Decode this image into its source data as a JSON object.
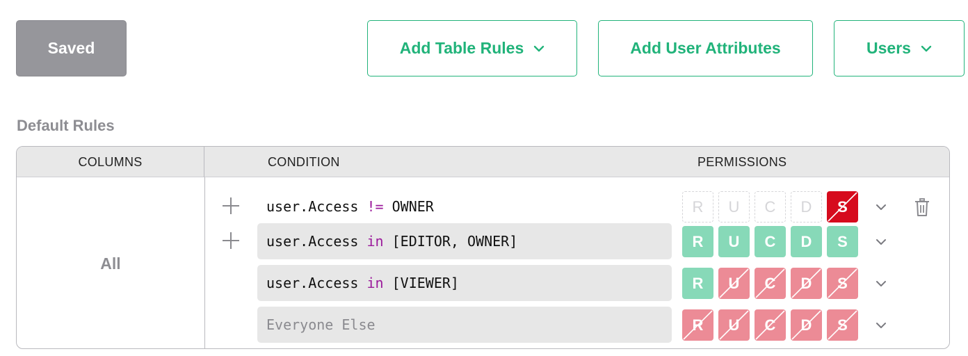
{
  "toolbar": {
    "saved_label": "Saved",
    "add_table_rules_label": "Add Table Rules",
    "add_user_attributes_label": "Add User Attributes",
    "users_label": "Users"
  },
  "section": {
    "title": "Default Rules"
  },
  "table": {
    "headers": {
      "columns": "COLUMNS",
      "condition": "CONDITION",
      "permissions": "PERMISSIONS"
    },
    "columns_value": "All",
    "rows": [
      {
        "condition_left": "user.Access",
        "condition_op": "!=",
        "condition_right": "OWNER",
        "has_add": true,
        "has_delete": true,
        "filled": false,
        "permissions": [
          {
            "label": "R",
            "state": "off"
          },
          {
            "label": "U",
            "state": "off"
          },
          {
            "label": "C",
            "state": "off"
          },
          {
            "label": "D",
            "state": "off"
          },
          {
            "label": "S",
            "state": "deny-strong"
          }
        ]
      },
      {
        "condition_left": "user.Access",
        "condition_op": "in",
        "condition_right": "[EDITOR, OWNER]",
        "has_add": true,
        "has_delete": false,
        "filled": true,
        "permissions": [
          {
            "label": "R",
            "state": "allow"
          },
          {
            "label": "U",
            "state": "allow"
          },
          {
            "label": "C",
            "state": "allow"
          },
          {
            "label": "D",
            "state": "allow"
          },
          {
            "label": "S",
            "state": "allow"
          }
        ]
      },
      {
        "condition_left": "user.Access",
        "condition_op": "in",
        "condition_right": "[VIEWER]",
        "has_add": false,
        "has_delete": false,
        "filled": true,
        "permissions": [
          {
            "label": "R",
            "state": "allow"
          },
          {
            "label": "U",
            "state": "deny"
          },
          {
            "label": "C",
            "state": "deny"
          },
          {
            "label": "D",
            "state": "deny"
          },
          {
            "label": "S",
            "state": "deny"
          }
        ]
      },
      {
        "condition_placeholder": "Everyone Else",
        "has_add": false,
        "has_delete": false,
        "filled": true,
        "permissions": [
          {
            "label": "R",
            "state": "deny"
          },
          {
            "label": "U",
            "state": "deny"
          },
          {
            "label": "C",
            "state": "deny"
          },
          {
            "label": "D",
            "state": "deny"
          },
          {
            "label": "S",
            "state": "deny"
          }
        ]
      }
    ]
  },
  "colors": {
    "accent": "#21b37a",
    "allow": "#87d9b8",
    "deny": "#ec8b96",
    "deny_strong": "#d60b1d",
    "keyword": "#9b1a9b",
    "saved_bg": "#96969b"
  },
  "icons": {
    "dropdown": "chevron-down-icon",
    "add": "plus-icon",
    "delete": "trash-icon",
    "denied": "slash-icon"
  }
}
